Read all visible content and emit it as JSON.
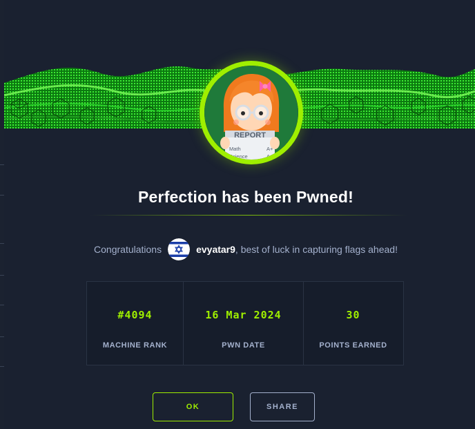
{
  "dialog": {
    "title": "Perfection has been Pwned!",
    "congrats_prefix": "Congratulations",
    "username": "evyatar9",
    "congrats_suffix": ", best of luck in capturing flags ahead!"
  },
  "avatar": {
    "icon": "report-card-avatar-icon",
    "sign_title": "REPORT",
    "row1_subject": "Math",
    "row1_grade": "A+",
    "row2_subject": "Science",
    "row2_grade": "A+"
  },
  "flag": {
    "icon": "israel-flag-icon"
  },
  "stats": [
    {
      "value": "#4094",
      "label": "MACHINE RANK"
    },
    {
      "value": "16 Mar 2024",
      "label": "PWN DATE"
    },
    {
      "value": "30",
      "label": "POINTS EARNED"
    }
  ],
  "buttons": {
    "ok_label": "OK",
    "share_label": "SHARE"
  },
  "colors": {
    "accent": "#9fef00",
    "background": "#1a2130",
    "muted_text": "#a4b1cd"
  }
}
